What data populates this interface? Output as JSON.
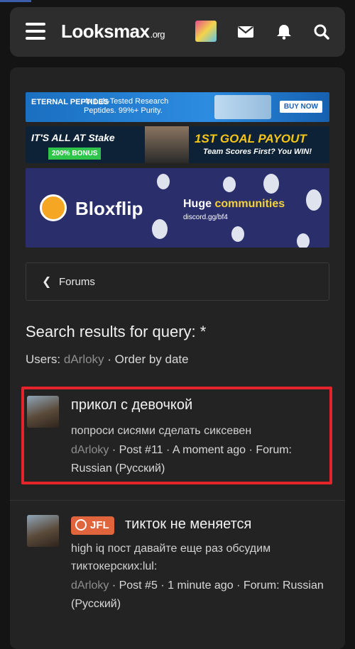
{
  "header": {
    "logo_main": "Looksmax",
    "logo_sub": ".org",
    "icons": [
      "menu-icon",
      "mail-icon",
      "bell-icon",
      "search-icon"
    ]
  },
  "ads": {
    "eternal": {
      "brand": "ETERNAL PEPTIDES",
      "text": "4x Lab-Tested Research Peptides. 99%+ Purity.",
      "button": "BUY NOW"
    },
    "stake": {
      "headline": "IT'S ALL AT Stake",
      "bonus": "200% BONUS",
      "goal": "1ST GOAL PAYOUT",
      "sub": "Team Scores First? You WIN!"
    },
    "bloxflip": {
      "name": "Bloxflip",
      "huge": "Huge",
      "communities": "communities",
      "discord": "discord.gg/bf4"
    }
  },
  "nav": {
    "forums_label": "Forums"
  },
  "search": {
    "title": "Search results for query: *",
    "users_label": "Users:",
    "user": "dArloky",
    "order": "Order by date"
  },
  "results": [
    {
      "title": "прикол с девочкой",
      "snippet": "попроси сисями сделать сиксевен",
      "author": "dArloky",
      "post": "Post #11",
      "time": "A moment ago",
      "forum_label": "Forum:",
      "forum": "Russian (Русский)"
    },
    {
      "prefix": "JFL",
      "title": "тикток не меняется",
      "snippet": "high iq пост давайте еще раз обсудим тиктокерских:lul:",
      "author": "dArloky",
      "post": "Post #5",
      "time": "1 minute ago",
      "forum_label": "Forum:",
      "forum": "Russian (Русский)"
    }
  ],
  "colors": {
    "highlight_border": "#e3242b",
    "prefix_bg": "#e0643c",
    "muted_link": "#8e8e8e"
  }
}
